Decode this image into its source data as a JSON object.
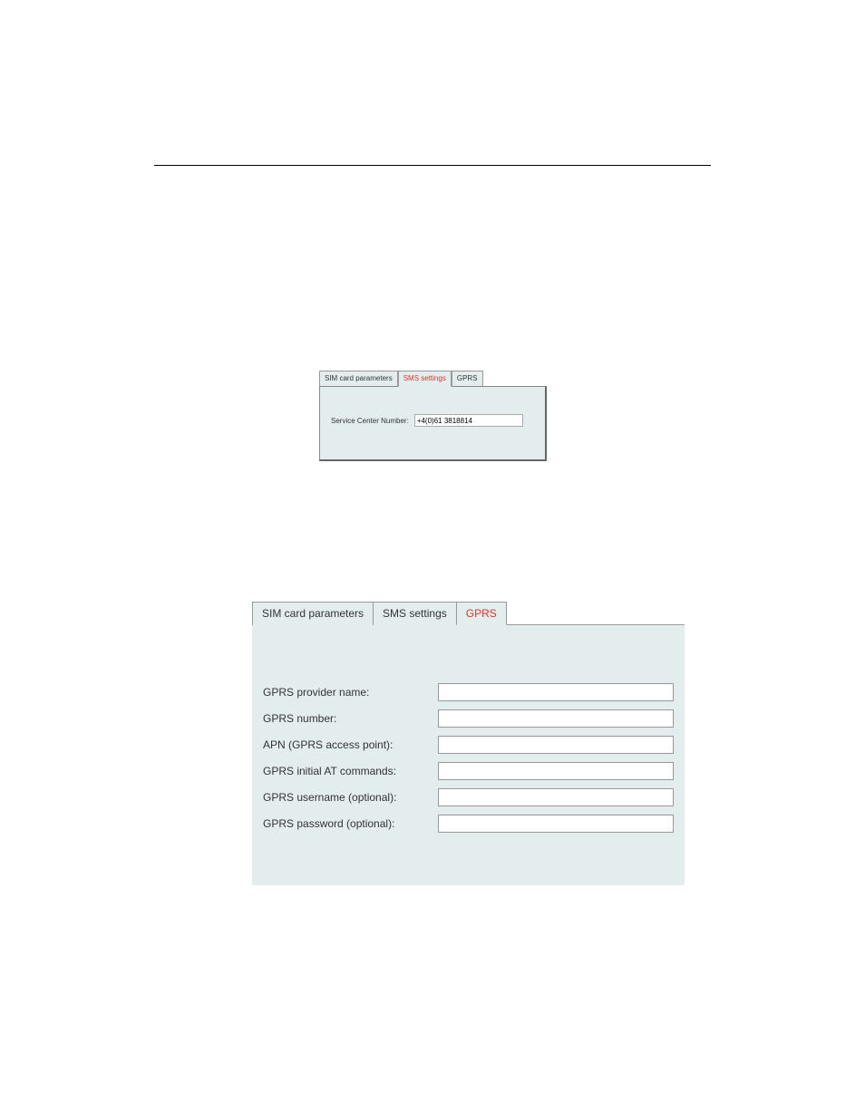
{
  "hr": {},
  "panel1": {
    "tabs": {
      "sim": "SIM card parameters",
      "sms": "SMS settings",
      "gprs": "GPRS"
    },
    "active": "sms",
    "field_label": "Service Center Number:",
    "field_value": "+4(0)61 3818814"
  },
  "panel2": {
    "tabs": {
      "sim": "SIM card parameters",
      "sms": "SMS settings",
      "gprs": "GPRS"
    },
    "active": "gprs",
    "fields": [
      {
        "label": "GPRS provider name:",
        "value": ""
      },
      {
        "label": "GPRS number:",
        "value": ""
      },
      {
        "label": "APN (GPRS access point):",
        "value": ""
      },
      {
        "label": "GPRS initial AT commands:",
        "value": ""
      },
      {
        "label": "GPRS username (optional):",
        "value": ""
      },
      {
        "label": "GPRS password (optional):",
        "value": ""
      }
    ]
  }
}
